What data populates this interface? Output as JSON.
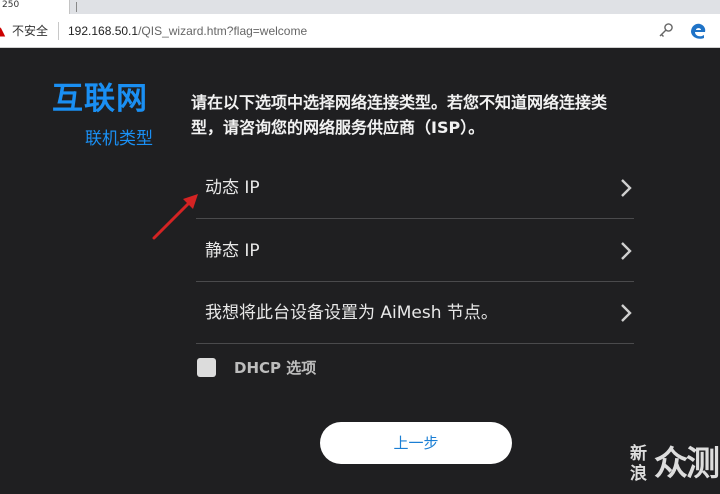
{
  "browser": {
    "tab_title": "250",
    "tab_plus": "+",
    "security_label": "不安全",
    "url_host": "192.168.50.1",
    "url_path": "/QIS_wizard.htm?flag=welcome"
  },
  "header": {
    "title": "互联网",
    "subtitle": "联机类型"
  },
  "description": "请在以下选项中选择网络连接类型。若您不知道网络连接类型，请咨询您的网络服务供应商（ISP）。",
  "options": [
    {
      "label": "动态 IP"
    },
    {
      "label": "静态 IP"
    },
    {
      "label": "我想将此台设备设置为 AiMesh 节点。"
    }
  ],
  "dhcp": {
    "label": "DHCP 选项",
    "checked": false
  },
  "prev_button": "上一步",
  "watermark": {
    "line1": "新",
    "line2": "浪",
    "big": "众测"
  },
  "colors": {
    "accent": "#1a8ff3",
    "background": "#1f1f21",
    "arrow": "#d42323"
  }
}
